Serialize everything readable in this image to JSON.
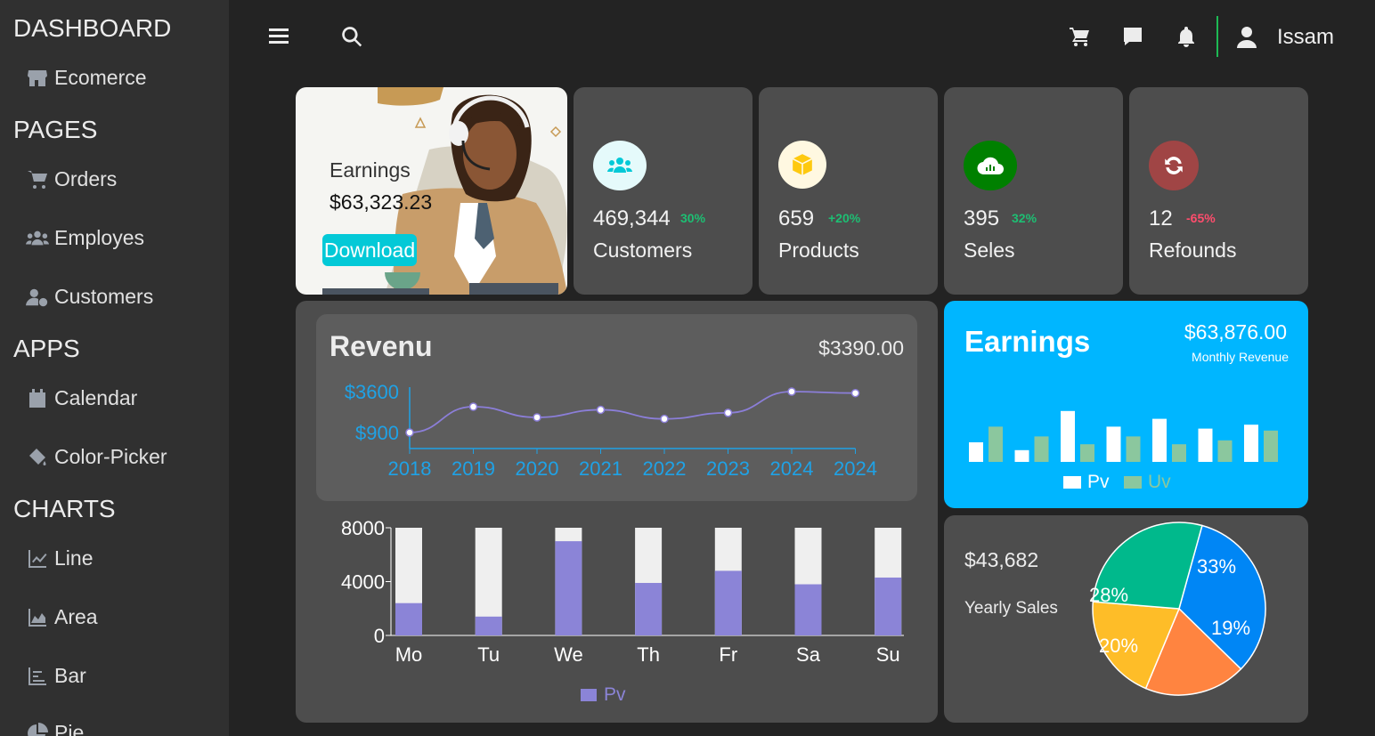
{
  "sidebar": {
    "sections": [
      {
        "title": "DASHBOARD",
        "items": [
          {
            "label": "Ecomerce",
            "icon": "store-icon"
          }
        ]
      },
      {
        "title": "PAGES",
        "items": [
          {
            "label": "Orders",
            "icon": "cart-icon"
          },
          {
            "label": "Employes",
            "icon": "users-icon"
          },
          {
            "label": "Customers",
            "icon": "user-gear-icon"
          }
        ]
      },
      {
        "title": "APPS",
        "items": [
          {
            "label": "Calendar",
            "icon": "calendar-icon"
          },
          {
            "label": "Color-Picker",
            "icon": "paint-bucket-icon"
          }
        ]
      },
      {
        "title": "CHARTS",
        "items": [
          {
            "label": "Line",
            "icon": "line-chart-icon"
          },
          {
            "label": "Area",
            "icon": "area-chart-icon"
          },
          {
            "label": "Bar",
            "icon": "bar-chart-icon"
          },
          {
            "label": "Pie",
            "icon": "pie-chart-icon"
          }
        ]
      }
    ]
  },
  "topbar": {
    "user_name": "Issam",
    "divider_color": "#1db954"
  },
  "earnings_card": {
    "label": "Earnings",
    "amount": "$63,323.23",
    "download_label": "Download",
    "button_color": "#03c9d7"
  },
  "stats": [
    {
      "value": "469,344",
      "percent": "30%",
      "label": "Customers",
      "icon": "users-icon",
      "icon_bg": "#e5fafb",
      "icon_color": "#03c9d7",
      "percent_color": "#1dbf73"
    },
    {
      "value": "659",
      "percent": "+20%",
      "label": "Products",
      "icon": "box-icon",
      "icon_bg": "#fff8e1",
      "icon_color": "#fec90f",
      "percent_color": "#1dbf73"
    },
    {
      "value": "395",
      "percent": "32%",
      "label": "Seles",
      "icon": "cloud-chart-icon",
      "icon_bg": "#008000",
      "icon_color": "#ffffff",
      "percent_color": "#1dbf73"
    },
    {
      "value": "12",
      "percent": "-65%",
      "label": "Refounds",
      "icon": "refresh-icon",
      "icon_bg": "#a04545",
      "icon_color": "#ffffff",
      "percent_color": "#ff4d6d"
    }
  ],
  "revenue": {
    "title": "Revenu",
    "amount": "$3390.00"
  },
  "earnings_panel": {
    "title": "Earnings",
    "amount": "$63,876.00",
    "subtitle": "Monthly Revenue",
    "bg": "#00b6ff"
  },
  "yearly": {
    "amount": "$43,682",
    "label": "Yearly Sales"
  },
  "chart_data": [
    {
      "type": "line",
      "x": [
        "2018",
        "2019",
        "2020",
        "2021",
        "2022",
        "2023",
        "2024",
        "2024"
      ],
      "y": [
        900,
        2600,
        1900,
        2400,
        1800,
        2200,
        3600,
        3500
      ],
      "yticks": [
        "$900",
        "$3600"
      ],
      "ylim": [
        900,
        3600
      ],
      "color": "#8b7ed8",
      "axis_color": "#1fa2e6"
    },
    {
      "type": "bar",
      "categories": [
        "Mo",
        "Tu",
        "We",
        "Th",
        "Fr",
        "Sa",
        "Su"
      ],
      "series": [
        {
          "name": "Pv",
          "values": [
            2400,
            1400,
            7000,
            3900,
            4800,
            3800,
            4300
          ]
        }
      ],
      "max": 8000,
      "yticks": [
        0,
        4000,
        8000
      ],
      "colors": {
        "fill": "#8b84d7",
        "bg": "#efefef"
      }
    },
    {
      "type": "bar",
      "series": [
        {
          "name": "Pv",
          "values": [
            1,
            0.6,
            2.6,
            1.8,
            2.2,
            1.7,
            1.9
          ]
        },
        {
          "name": "Uv",
          "values": [
            1.8,
            1.3,
            0.9,
            1.3,
            0.9,
            1.1,
            1.6
          ]
        }
      ],
      "colors": {
        "Pv": "#ffffff",
        "Uv": "#8bc79e"
      }
    },
    {
      "type": "pie",
      "slices": [
        {
          "label": "33%",
          "value": 33,
          "color": "#0086f5"
        },
        {
          "label": "19%",
          "value": 19,
          "color": "#ff8440"
        },
        {
          "label": "20%",
          "value": 20,
          "color": "#febd28"
        },
        {
          "label": "28%",
          "value": 28,
          "color": "#00b98c"
        }
      ]
    }
  ]
}
